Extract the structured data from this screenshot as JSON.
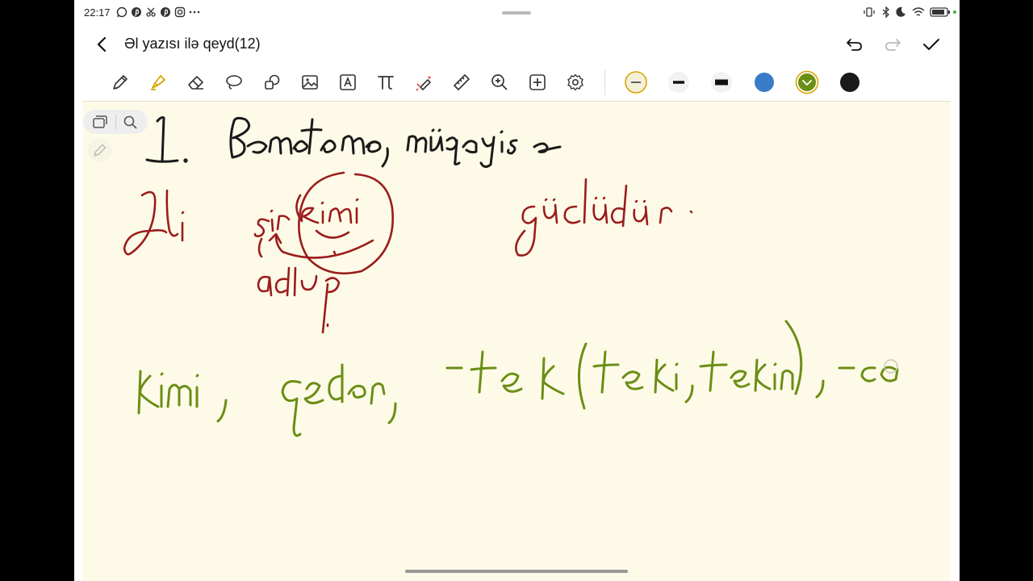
{
  "status_bar": {
    "time": "22:17",
    "app_icons": [
      "whatsapp-icon",
      "pinterest-icon",
      "scissors-icon",
      "pinterest-icon",
      "instagram-icon",
      "more-icon"
    ],
    "system_icons": [
      "vibrate-icon",
      "bluetooth-icon",
      "moon-icon",
      "wifi-icon",
      "battery-icon"
    ]
  },
  "title_bar": {
    "title": "Əl yazısı ilə qeyd(12)",
    "actions": [
      "back-icon",
      "undo-icon",
      "redo-icon",
      "check-icon"
    ]
  },
  "toolbar": {
    "tools": [
      "pen-icon",
      "highlighter-icon",
      "eraser-icon",
      "lasso-icon",
      "shapes-icon",
      "image-icon",
      "text-icon",
      "formula-icon",
      "laser-icon",
      "ruler-icon",
      "zoom-icon",
      "add-icon",
      "settings-icon"
    ],
    "selected_tool": "highlighter-icon",
    "stroke_sizes": [
      "thin",
      "medium",
      "thick"
    ],
    "selected_stroke": "thin",
    "colors": [
      "#3a7bc8",
      "#6a8f14",
      "#1a1a1a"
    ],
    "selected_color": "#6a8f14"
  },
  "canvas": {
    "background": "#fdfbe8",
    "ink_colors": {
      "black": "#1a1a1a",
      "red": "#9b1c1c",
      "green": "#6b8e14"
    }
  }
}
